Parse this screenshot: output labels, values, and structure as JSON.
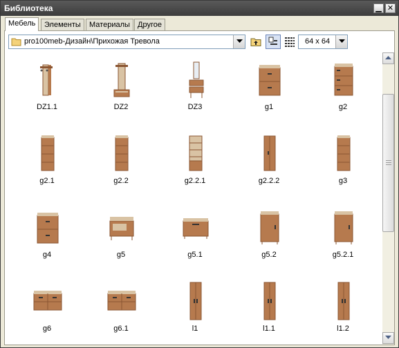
{
  "window": {
    "title": "Библиотека",
    "minimize_label": "▁",
    "close_label": "✕"
  },
  "tabs": [
    "Мебель",
    "Элементы",
    "Материалы",
    "Другое"
  ],
  "active_tab": 0,
  "toolbar": {
    "path": "pro100meb-Дизайн\\Прихожая Тревола",
    "thumb_size": "64 x  64"
  },
  "colors": {
    "wood": "#b67a4e",
    "wood_dark": "#8a5532",
    "wood_light": "#d9c3a4",
    "titlebar": "#4a4a4a"
  },
  "items": [
    {
      "label": "DZ1.1",
      "icon": "wall-coat-rack"
    },
    {
      "label": "DZ2",
      "icon": "hallway-hanger"
    },
    {
      "label": "DZ3",
      "icon": "mirror-vanity"
    },
    {
      "label": "g1",
      "icon": "two-drawer-cabinet"
    },
    {
      "label": "g2",
      "icon": "three-drawer-chest"
    },
    {
      "label": "g2.1",
      "icon": "tall-drawer-chest"
    },
    {
      "label": "g2.2",
      "icon": "tall-drawer-chest"
    },
    {
      "label": "g2.2.1",
      "icon": "open-shelf-unit"
    },
    {
      "label": "g2.2.2",
      "icon": "narrow-cabinet"
    },
    {
      "label": "g3",
      "icon": "tall-drawer-chest"
    },
    {
      "label": "g4",
      "icon": "two-drawer-cabinet"
    },
    {
      "label": "g5",
      "icon": "shoe-bench"
    },
    {
      "label": "g5.1",
      "icon": "low-cabinet"
    },
    {
      "label": "g5.2",
      "icon": "door-cabinet"
    },
    {
      "label": "g5.2.1",
      "icon": "door-cabinet"
    },
    {
      "label": "g6",
      "icon": "wide-dresser"
    },
    {
      "label": "g6.1",
      "icon": "wide-dresser"
    },
    {
      "label": "l1",
      "icon": "tall-wardrobe"
    },
    {
      "label": "l1.1",
      "icon": "tall-wardrobe"
    },
    {
      "label": "l1.2",
      "icon": "tall-wardrobe"
    }
  ]
}
